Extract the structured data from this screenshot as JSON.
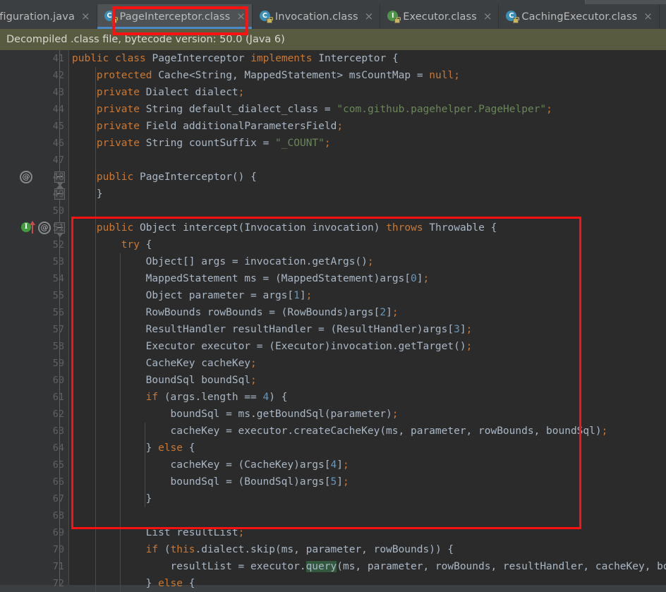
{
  "window": {
    "notification_bar": "Decompiled .class file, bytecode version: 50.0 (Java 6)"
  },
  "tabs": [
    {
      "label": "nfiguration.java",
      "icon": "java-class-icon",
      "active": false,
      "clipped": true,
      "close": "×"
    },
    {
      "label": "PageInterceptor.class",
      "icon": "class-locked-icon",
      "icon_letter": "C",
      "icon_kind": "c",
      "active": true,
      "close": "×"
    },
    {
      "label": "Invocation.class",
      "icon": "class-locked-icon",
      "icon_letter": "C",
      "icon_kind": "c",
      "active": false,
      "close": "×"
    },
    {
      "label": "Executor.class",
      "icon": "interface-locked-icon",
      "icon_letter": "I",
      "icon_kind": "i",
      "active": false,
      "close": "×"
    },
    {
      "label": "CachingExecutor.class",
      "icon": "class-locked-icon",
      "icon_letter": "C",
      "icon_kind": "c",
      "active": false,
      "close": "×"
    },
    {
      "label": "",
      "icon": "class-locked-icon",
      "icon_letter": "C",
      "icon_kind": "c",
      "active": false,
      "close": ""
    }
  ],
  "colors": {
    "editor_bg": "#2b2b2b",
    "gutter_bg": "#313335",
    "tabbar_bg": "#3c3f41",
    "active_tab_bg": "#4e5254",
    "tab_underline": "#3592c4",
    "notification_bg": "#585b40",
    "keyword": "#cc7832",
    "string": "#6a8759",
    "number": "#6897bb",
    "text": "#a9b7c6",
    "line_number": "#606366",
    "annotation_red": "#ff1111",
    "usage_highlight": "#32593d",
    "class_icon": "#3b8eb5",
    "interface_icon": "#4f924a"
  },
  "annotations": [
    {
      "name": "tab-highlight-box",
      "target": "PageInterceptor.class tab"
    },
    {
      "name": "intercept-method-box",
      "target": "intercept method body lines 51-70"
    }
  ],
  "code": {
    "first_line_number": 41,
    "lines": [
      {
        "n": 41,
        "tokens": [
          {
            "t": "public ",
            "c": "kw"
          },
          {
            "t": "class ",
            "c": "kw"
          },
          {
            "t": "PageInterceptor ",
            "c": "ident"
          },
          {
            "t": "implements ",
            "c": "kw"
          },
          {
            "t": "Interceptor {",
            "c": "ident"
          }
        ],
        "indent": 0
      },
      {
        "n": 42,
        "tokens": [
          {
            "t": "protected ",
            "c": "kw"
          },
          {
            "t": "Cache<String, MappedStatement> msCountMap = ",
            "c": "ident"
          },
          {
            "t": "null",
            "c": "kw"
          },
          {
            "t": ";",
            "c": "semi"
          }
        ],
        "indent": 1
      },
      {
        "n": 43,
        "tokens": [
          {
            "t": "private ",
            "c": "kw"
          },
          {
            "t": "Dialect dialect",
            "c": "ident"
          },
          {
            "t": ";",
            "c": "semi"
          }
        ],
        "indent": 1
      },
      {
        "n": 44,
        "tokens": [
          {
            "t": "private ",
            "c": "kw"
          },
          {
            "t": "String default_dialect_class = ",
            "c": "ident"
          },
          {
            "t": "\"com.github.pagehelper.PageHelper\"",
            "c": "str"
          },
          {
            "t": ";",
            "c": "semi"
          }
        ],
        "indent": 1
      },
      {
        "n": 45,
        "tokens": [
          {
            "t": "private ",
            "c": "kw"
          },
          {
            "t": "Field additionalParametersField",
            "c": "ident"
          },
          {
            "t": ";",
            "c": "semi"
          }
        ],
        "indent": 1
      },
      {
        "n": 46,
        "tokens": [
          {
            "t": "private ",
            "c": "kw"
          },
          {
            "t": "String countSuffix = ",
            "c": "ident"
          },
          {
            "t": "\"_COUNT\"",
            "c": "str"
          },
          {
            "t": ";",
            "c": "semi"
          }
        ],
        "indent": 1
      },
      {
        "n": 47,
        "tokens": [],
        "indent": 1
      },
      {
        "n": 48,
        "tokens": [
          {
            "t": "public ",
            "c": "kw"
          },
          {
            "t": "PageInterceptor() {",
            "c": "ident"
          }
        ],
        "indent": 1,
        "gutter": "annotation"
      },
      {
        "n": 49,
        "tokens": [
          {
            "t": "}",
            "c": "ident"
          }
        ],
        "indent": 1
      },
      {
        "n": 50,
        "tokens": [],
        "indent": 1
      },
      {
        "n": 51,
        "tokens": [
          {
            "t": "public ",
            "c": "kw"
          },
          {
            "t": "Object intercept(Invocation invocation) ",
            "c": "ident"
          },
          {
            "t": "throws ",
            "c": "kw"
          },
          {
            "t": "Throwable {",
            "c": "ident"
          }
        ],
        "indent": 1,
        "gutter": "implements-annotation"
      },
      {
        "n": 52,
        "tokens": [
          {
            "t": "try",
            "c": "kw"
          },
          {
            "t": " {",
            "c": "ident"
          }
        ],
        "indent": 2
      },
      {
        "n": 53,
        "tokens": [
          {
            "t": "Object[] args = invocation.getArgs()",
            "c": "ident"
          },
          {
            "t": ";",
            "c": "semi"
          }
        ],
        "indent": 3
      },
      {
        "n": 54,
        "tokens": [
          {
            "t": "MappedStatement ms = (MappedStatement)args[",
            "c": "ident"
          },
          {
            "t": "0",
            "c": "num"
          },
          {
            "t": "]",
            "c": "ident"
          },
          {
            "t": ";",
            "c": "semi"
          }
        ],
        "indent": 3
      },
      {
        "n": 55,
        "tokens": [
          {
            "t": "Object parameter = args[",
            "c": "ident"
          },
          {
            "t": "1",
            "c": "num"
          },
          {
            "t": "]",
            "c": "ident"
          },
          {
            "t": ";",
            "c": "semi"
          }
        ],
        "indent": 3
      },
      {
        "n": 56,
        "tokens": [
          {
            "t": "RowBounds rowBounds = (RowBounds)args[",
            "c": "ident"
          },
          {
            "t": "2",
            "c": "num"
          },
          {
            "t": "]",
            "c": "ident"
          },
          {
            "t": ";",
            "c": "semi"
          }
        ],
        "indent": 3
      },
      {
        "n": 57,
        "tokens": [
          {
            "t": "ResultHandler resultHandler = (ResultHandler)args[",
            "c": "ident"
          },
          {
            "t": "3",
            "c": "num"
          },
          {
            "t": "]",
            "c": "ident"
          },
          {
            "t": ";",
            "c": "semi"
          }
        ],
        "indent": 3
      },
      {
        "n": 58,
        "tokens": [
          {
            "t": "Executor executor = (Executor)invocation.getTarget()",
            "c": "ident"
          },
          {
            "t": ";",
            "c": "semi"
          }
        ],
        "indent": 3
      },
      {
        "n": 59,
        "tokens": [
          {
            "t": "CacheKey cacheKey",
            "c": "ident"
          },
          {
            "t": ";",
            "c": "semi"
          }
        ],
        "indent": 3
      },
      {
        "n": 60,
        "tokens": [
          {
            "t": "BoundSql boundSql",
            "c": "ident"
          },
          {
            "t": ";",
            "c": "semi"
          }
        ],
        "indent": 3
      },
      {
        "n": 61,
        "tokens": [
          {
            "t": "if",
            "c": "kw"
          },
          {
            "t": " (args.length == ",
            "c": "ident"
          },
          {
            "t": "4",
            "c": "num"
          },
          {
            "t": ") {",
            "c": "ident"
          }
        ],
        "indent": 3
      },
      {
        "n": 62,
        "tokens": [
          {
            "t": "boundSql = ms.getBoundSql(parameter)",
            "c": "ident"
          },
          {
            "t": ";",
            "c": "semi"
          }
        ],
        "indent": 4
      },
      {
        "n": 63,
        "tokens": [
          {
            "t": "cacheKey = executor.createCacheKey(ms, parameter, rowBounds, boundSql)",
            "c": "ident"
          },
          {
            "t": ";",
            "c": "semi"
          }
        ],
        "indent": 4
      },
      {
        "n": 64,
        "tokens": [
          {
            "t": "} ",
            "c": "ident"
          },
          {
            "t": "else",
            "c": "kw"
          },
          {
            "t": " {",
            "c": "ident"
          }
        ],
        "indent": 3
      },
      {
        "n": 65,
        "tokens": [
          {
            "t": "cacheKey = (CacheKey)args[",
            "c": "ident"
          },
          {
            "t": "4",
            "c": "num"
          },
          {
            "t": "]",
            "c": "ident"
          },
          {
            "t": ";",
            "c": "semi"
          }
        ],
        "indent": 4
      },
      {
        "n": 66,
        "tokens": [
          {
            "t": "boundSql = (BoundSql)args[",
            "c": "ident"
          },
          {
            "t": "5",
            "c": "num"
          },
          {
            "t": "]",
            "c": "ident"
          },
          {
            "t": ";",
            "c": "semi"
          }
        ],
        "indent": 4
      },
      {
        "n": 67,
        "tokens": [
          {
            "t": "}",
            "c": "ident"
          }
        ],
        "indent": 3
      },
      {
        "n": 68,
        "tokens": [],
        "indent": 3
      },
      {
        "n": 69,
        "tokens": [
          {
            "t": "List resultList",
            "c": "ident"
          },
          {
            "t": ";",
            "c": "semi"
          }
        ],
        "indent": 3
      },
      {
        "n": 70,
        "tokens": [
          {
            "t": "if",
            "c": "kw"
          },
          {
            "t": " (",
            "c": "ident"
          },
          {
            "t": "this",
            "c": "kw"
          },
          {
            "t": ".dialect.skip(ms, parameter, rowBounds)) {",
            "c": "ident"
          }
        ],
        "indent": 3
      },
      {
        "n": 71,
        "tokens": [
          {
            "t": "resultList = executor.",
            "c": "ident"
          },
          {
            "t": "query",
            "c": "hl"
          },
          {
            "t": "(ms, parameter, rowBounds, resultHandler, cacheKey, boundSql)",
            "c": "ident"
          },
          {
            "t": ";",
            "c": "semi"
          }
        ],
        "indent": 4
      },
      {
        "n": 72,
        "tokens": [
          {
            "t": "} ",
            "c": "ident"
          },
          {
            "t": "else",
            "c": "kw"
          },
          {
            "t": " {",
            "c": "ident"
          }
        ],
        "indent": 3
      }
    ]
  }
}
